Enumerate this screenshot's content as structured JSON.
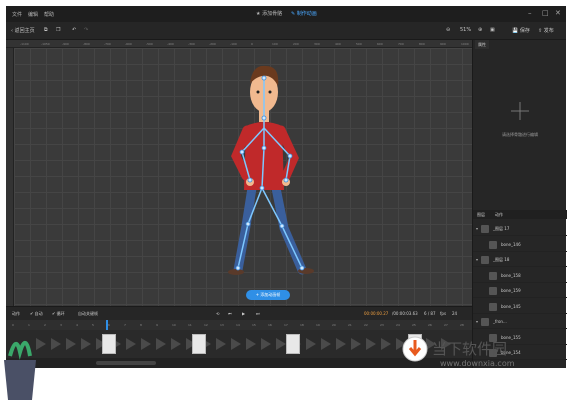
{
  "menubar": {
    "menus": [
      "文件",
      "编辑",
      "帮助"
    ],
    "modes": [
      {
        "label": "添加骨骼",
        "active": false
      },
      {
        "label": "制作动画",
        "active": true
      }
    ]
  },
  "toolbar": {
    "back_label": "返回主页",
    "zoom": "51%",
    "save_label": "保存",
    "publish_label": "发布"
  },
  "ruler_ticks": [
    "-1100",
    "-1050",
    "-900",
    "-800",
    "-700",
    "-600",
    "-500",
    "-400",
    "-300",
    "-200",
    "-100",
    "0",
    "100",
    "200",
    "300",
    "400",
    "500",
    "600",
    "700",
    "800",
    "900",
    "1000"
  ],
  "right_panel": {
    "tab": "属性",
    "empty_hint": "请选择骨骼进行编辑",
    "layer_tabs": [
      "图层",
      "动作"
    ],
    "layers": [
      {
        "label": "_图层 17",
        "group": true
      },
      {
        "label": "bone_146",
        "group": false
      },
      {
        "label": "_图层 18",
        "group": true
      },
      {
        "label": "bone_158",
        "group": false
      },
      {
        "label": "bone_159",
        "group": false
      },
      {
        "label": "bone_145",
        "group": false
      },
      {
        "label": "_fron...",
        "group": true
      },
      {
        "label": "bone_155",
        "group": false
      },
      {
        "label": "bone_154",
        "group": false
      }
    ]
  },
  "timeline": {
    "add_action_label": "添加动画帧",
    "motion_label": "动作",
    "loop_label": "自动",
    "onion_label": "循环",
    "auto_key_label": "自动关键帧",
    "current_time": "00:00:00.27",
    "total_time": "/00:00:03.63",
    "frame_counter": "6 / 87",
    "fps_label": "fps",
    "fps_value": "24",
    "frame_numbers": [
      "0",
      "1",
      "2",
      "3",
      "4",
      "5",
      "6",
      "7",
      "8",
      "9",
      "10",
      "11",
      "12",
      "13",
      "14",
      "15",
      "16",
      "17",
      "18",
      "19",
      "20",
      "21",
      "22",
      "23",
      "24",
      "25",
      "26",
      "27",
      "28"
    ]
  },
  "watermark": {
    "cn": "当下软件园",
    "url": "www.downxia.com"
  },
  "colors": {
    "accent": "#2f8fe6",
    "shirt": "#c0292a",
    "bone": "#7ec8ff"
  }
}
